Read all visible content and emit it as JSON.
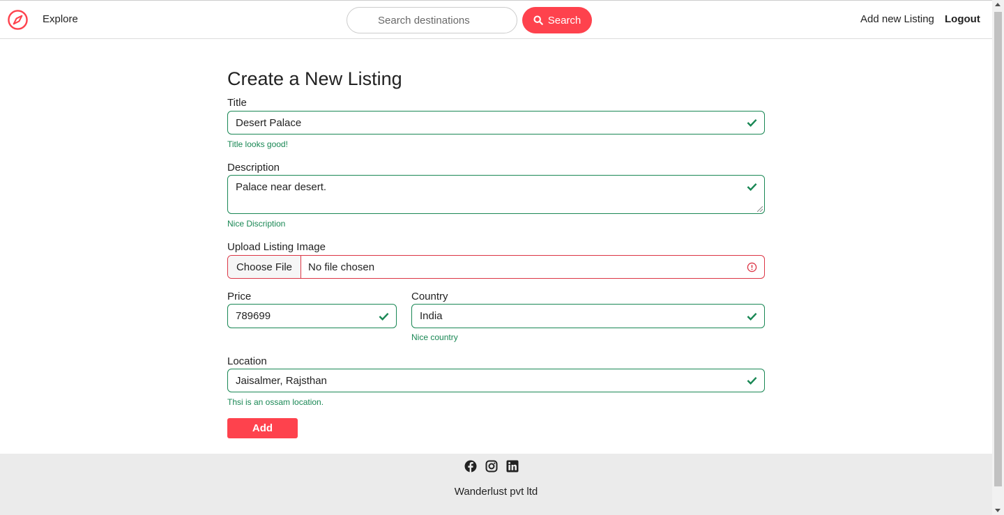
{
  "nav": {
    "explore": "Explore",
    "search_placeholder": "Search destinations",
    "search_button": "Search",
    "add_listing": "Add new Listing",
    "logout": "Logout"
  },
  "form": {
    "heading": "Create a New Listing",
    "title": {
      "label": "Title",
      "value": "Desert Palace",
      "feedback": "Title looks good!"
    },
    "description": {
      "label": "Description",
      "value": "Palace near desert.",
      "feedback": "Nice Discription"
    },
    "image": {
      "label": "Upload Listing Image",
      "button": "Choose File",
      "status": "No file chosen"
    },
    "price": {
      "label": "Price",
      "value": "789699"
    },
    "country": {
      "label": "Country",
      "value": "India",
      "feedback": "Nice country"
    },
    "location": {
      "label": "Location",
      "value": "Jaisalmer, Rajsthan",
      "feedback": "Thsi is an ossam location."
    },
    "submit": "Add"
  },
  "footer": {
    "company": "Wanderlust pvt ltd",
    "social_icons": [
      "facebook-icon",
      "instagram-icon",
      "linkedin-icon"
    ]
  },
  "colors": {
    "brand": "#fe424d",
    "valid": "#198754",
    "invalid": "#dc3545",
    "footer_bg": "#ebebeb"
  }
}
